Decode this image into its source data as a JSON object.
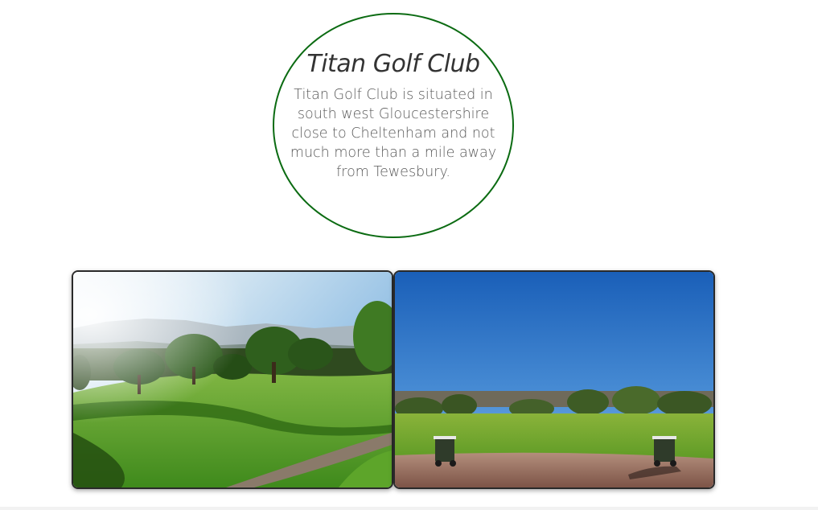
{
  "hero": {
    "title": "Titan Golf Club",
    "description": "Titan Golf Club is situated in south west Gloucestershire close to Cheltenham and not much more than a mile away from Tewesbury.",
    "border_color": "#0b6b12"
  },
  "gallery": {
    "photos": [
      {
        "subject": "golf-course-fairway-trees-mountains"
      },
      {
        "subject": "golf-course-tee-with-golf-carts"
      }
    ]
  }
}
